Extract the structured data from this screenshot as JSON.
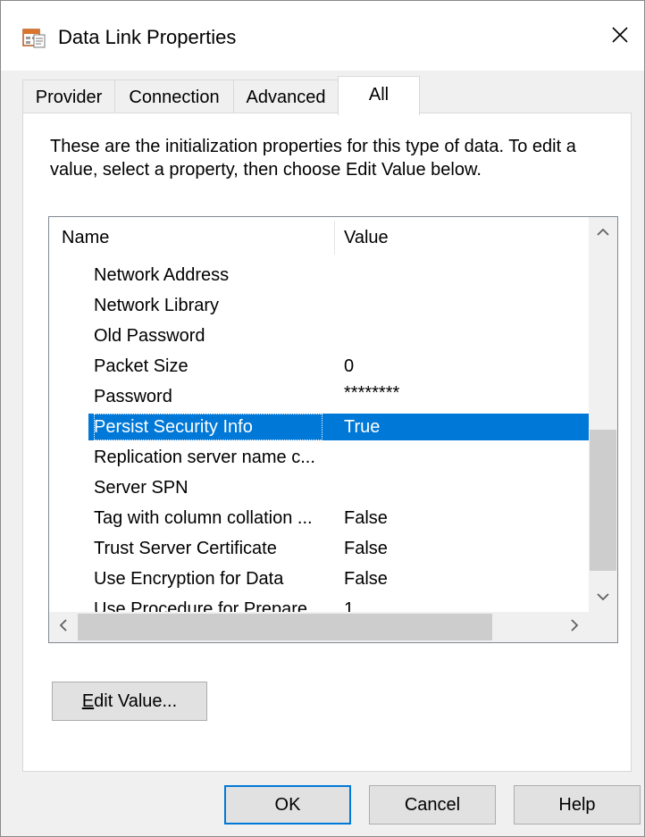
{
  "window": {
    "title": "Data Link Properties"
  },
  "tabs": [
    {
      "label": "Provider",
      "active": false
    },
    {
      "label": "Connection",
      "active": false
    },
    {
      "label": "Advanced",
      "active": false
    },
    {
      "label": "All",
      "active": true
    }
  ],
  "description": "These are the initialization properties for this type of data. To edit a value, select a property, then choose Edit Value below.",
  "list": {
    "columns": {
      "name": "Name",
      "value": "Value"
    },
    "rows": [
      {
        "name": "Network Address",
        "value": ""
      },
      {
        "name": "Network Library",
        "value": ""
      },
      {
        "name": "Old Password",
        "value": ""
      },
      {
        "name": "Packet Size",
        "value": "0"
      },
      {
        "name": "Password",
        "value": "********"
      },
      {
        "name": "Persist Security Info",
        "value": "True",
        "selected": true
      },
      {
        "name": "Replication server name c...",
        "value": ""
      },
      {
        "name": "Server SPN",
        "value": ""
      },
      {
        "name": "Tag with column collation ...",
        "value": "False"
      },
      {
        "name": "Trust Server Certificate",
        "value": "False"
      },
      {
        "name": "Use Encryption for Data",
        "value": "False"
      },
      {
        "name": "Use Procedure for Prepare",
        "value": "1"
      }
    ]
  },
  "buttons": {
    "edit_value_prefix": "E",
    "edit_value_rest": "dit Value...",
    "ok": "OK",
    "cancel": "Cancel",
    "help": "Help"
  },
  "colors": {
    "selection": "#0078d7",
    "default_button_border": "#0078d7"
  }
}
